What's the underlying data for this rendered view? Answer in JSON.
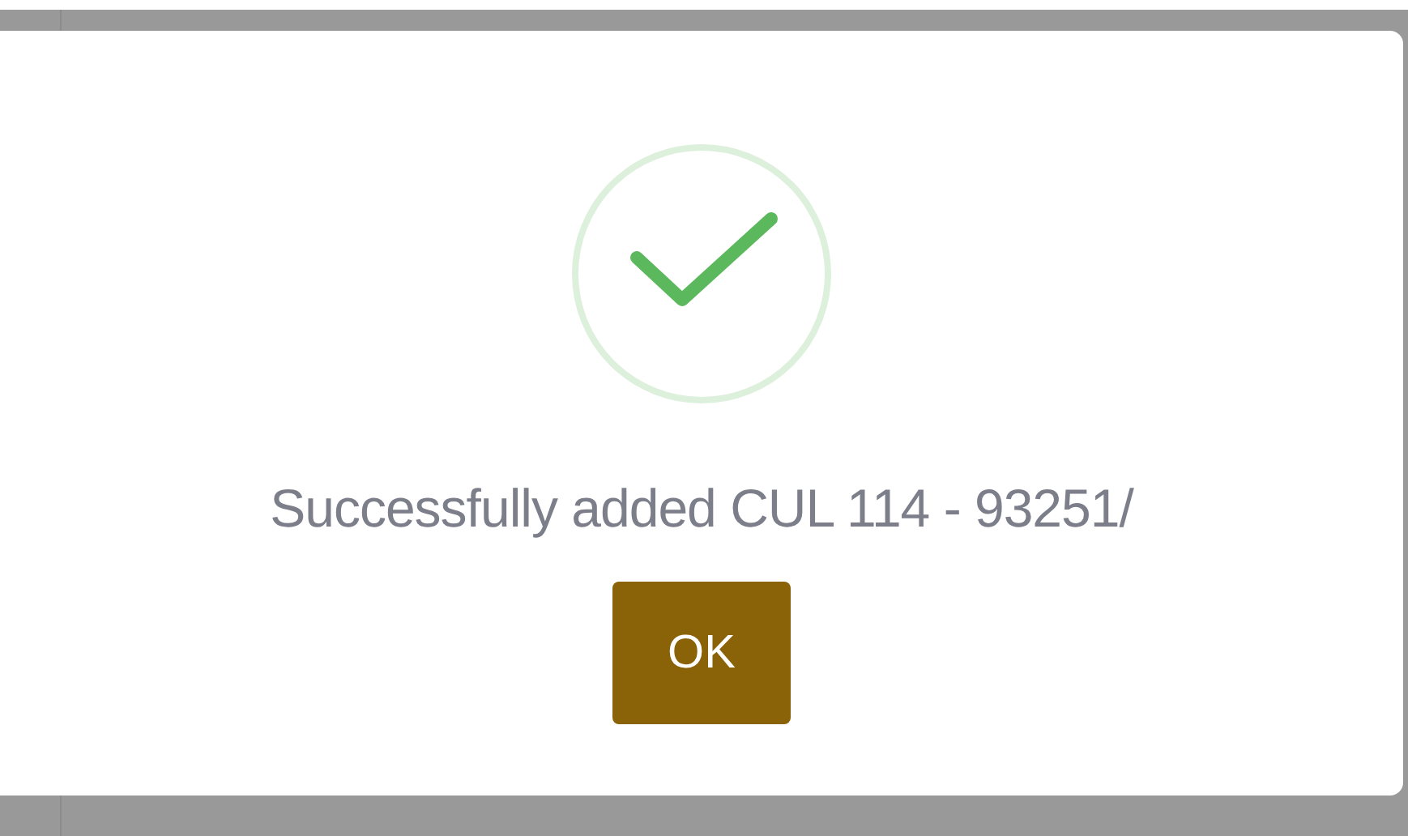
{
  "dialog": {
    "kind": "success",
    "message": "Successfully added CUL 114 - 93251/",
    "buttons": [
      "OK"
    ]
  }
}
